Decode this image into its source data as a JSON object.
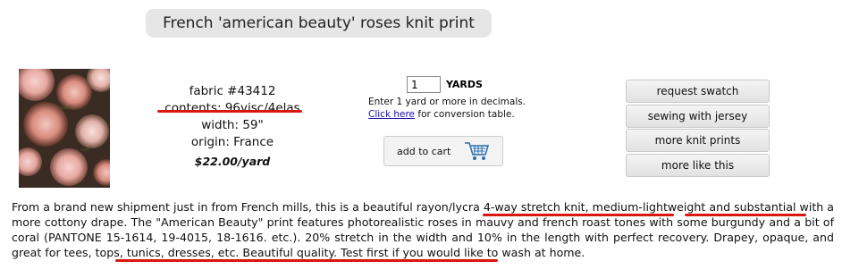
{
  "product": {
    "title": "French 'american beauty' roses knit print",
    "fabric": "fabric #43412",
    "contents": "contents: 96visc/4elas",
    "width": "width: 59\"",
    "origin": "origin: France",
    "price": "$22.00/yard"
  },
  "order": {
    "quantity": "1",
    "unit": "YARDS",
    "help_line": "Enter 1 yard or more in decimals.",
    "click_here": "Click here",
    "help_suffix": " for conversion table.",
    "add_to_cart": "add to cart"
  },
  "side_buttons": [
    {
      "label": "request swatch"
    },
    {
      "label": "sewing with jersey"
    },
    {
      "label": "more knit prints"
    },
    {
      "label": "more like this"
    }
  ],
  "description": {
    "p1": "From a brand new shipment just in from French mills, this is a beautiful ",
    "h1": "rayon/lycra 4-way stretch knit",
    "p2": ", ",
    "h2": "medium-lightweight",
    "p3": " and substantial with a more cottony drape. The \"American Beauty\" print features photorealistic roses in mauvy and french roast tones with some burgundy and a bit of coral (PANTONE 15-1614, 19-4015, 18-1616. etc.). 20% stretch in the width and 10% in the length with perfect recovery. ",
    "h3": "Drapey, opaque, and great for tees, tops, tunics, dresses, etc.",
    "p4": " Beautiful quality. Test first if you would like to wash at home."
  },
  "colors": {
    "highlight_underline": "#d8170f",
    "title_bg": "#e6e6e6"
  }
}
